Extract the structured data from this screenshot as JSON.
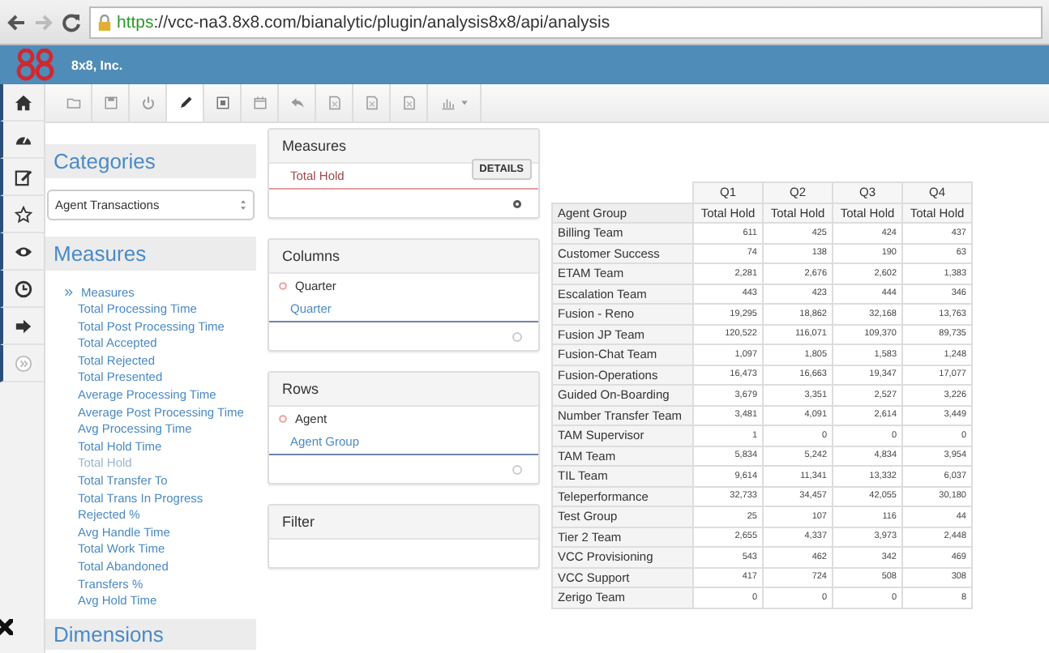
{
  "browser": {
    "url_scheme": "https",
    "url_rest": "://vcc-na3.8x8.com/bianalytic/plugin/analysis8x8/api/analysis"
  },
  "header": {
    "company": "8x8, Inc."
  },
  "side_nav": [
    {
      "kind": "home"
    },
    {
      "kind": "dashboard"
    },
    {
      "kind": "edit"
    },
    {
      "kind": "star"
    },
    {
      "kind": "eye"
    },
    {
      "kind": "clock"
    },
    {
      "kind": "signout"
    },
    {
      "kind": "expand"
    }
  ],
  "toolbar": [
    {
      "kind": "folder",
      "selected": false
    },
    {
      "kind": "save",
      "selected": false
    },
    {
      "kind": "power",
      "selected": false
    },
    {
      "kind": "pencil",
      "selected": true
    },
    {
      "kind": "play",
      "selected": false
    },
    {
      "kind": "calendar",
      "selected": false
    },
    {
      "kind": "undo",
      "selected": false
    },
    {
      "kind": "doc",
      "selected": false
    },
    {
      "kind": "doc",
      "selected": false
    },
    {
      "kind": "doc",
      "selected": false
    },
    {
      "kind": "chart",
      "selected": false
    }
  ],
  "categories": {
    "title": "Categories",
    "value": "Agent Transactions"
  },
  "measures_list": {
    "title": "Measures",
    "group": "Measures",
    "items": [
      {
        "label": "Total Processing Time",
        "disabled": false
      },
      {
        "label": "Total Post Processing Time",
        "disabled": false
      },
      {
        "label": "Total Accepted",
        "disabled": false
      },
      {
        "label": "Total Rejected",
        "disabled": false
      },
      {
        "label": "Total Presented",
        "disabled": false
      },
      {
        "label": "Average Processing Time",
        "disabled": false
      },
      {
        "label": "Average Post Processing Time",
        "disabled": false
      },
      {
        "label": "Avg Processing Time",
        "disabled": false
      },
      {
        "label": "Total Hold Time",
        "disabled": false
      },
      {
        "label": "Total Hold",
        "disabled": true
      },
      {
        "label": "Total Transfer To",
        "disabled": false
      },
      {
        "label": "Total Trans In Progress",
        "disabled": false
      },
      {
        "label": "Rejected %",
        "disabled": false
      },
      {
        "label": "Avg Handle Time",
        "disabled": false
      },
      {
        "label": "Total Work Time",
        "disabled": false
      },
      {
        "label": "Total Abandoned",
        "disabled": false
      },
      {
        "label": "Transfers %",
        "disabled": false
      },
      {
        "label": "Avg Hold Time",
        "disabled": false
      }
    ]
  },
  "dimensions": {
    "title": "Dimensions"
  },
  "drop_panels": [
    {
      "kind": "measures",
      "title": "Measures",
      "measure": "Total Hold",
      "button": "DETAILS"
    },
    {
      "kind": "dimension",
      "title": "Columns",
      "dimension": "Quarter",
      "level": "Quarter"
    },
    {
      "kind": "dimension",
      "title": "Rows",
      "dimension": "Agent",
      "level": "Agent Group"
    },
    {
      "kind": "filter",
      "title": "Filter"
    }
  ],
  "table": {
    "column_groups": [
      "Q1",
      "Q2",
      "Q3",
      "Q4"
    ],
    "row_header": "Agent Group",
    "measure_headers": [
      "Total Hold",
      "Total Hold",
      "Total Hold",
      "Total Hold"
    ],
    "rows": [
      {
        "label": "Billing Team",
        "values": [
          "611",
          "425",
          "424",
          "437"
        ]
      },
      {
        "label": "Customer Success",
        "values": [
          "74",
          "138",
          "190",
          "63"
        ]
      },
      {
        "label": "ETAM Team",
        "values": [
          "2,281",
          "2,676",
          "2,602",
          "1,383"
        ]
      },
      {
        "label": "Escalation Team",
        "values": [
          "443",
          "423",
          "444",
          "346"
        ]
      },
      {
        "label": "Fusion - Reno",
        "values": [
          "19,295",
          "18,862",
          "32,168",
          "13,763"
        ]
      },
      {
        "label": "Fusion JP Team",
        "values": [
          "120,522",
          "116,071",
          "109,370",
          "89,735"
        ]
      },
      {
        "label": "Fusion-Chat Team",
        "values": [
          "1,097",
          "1,805",
          "1,583",
          "1,248"
        ]
      },
      {
        "label": "Fusion-Operations",
        "values": [
          "16,473",
          "16,663",
          "19,347",
          "17,077"
        ]
      },
      {
        "label": "Guided On-Boarding",
        "values": [
          "3,679",
          "3,351",
          "2,527",
          "3,226"
        ]
      },
      {
        "label": "Number Transfer Team",
        "values": [
          "3,481",
          "4,091",
          "2,614",
          "3,449"
        ]
      },
      {
        "label": "TAM Supervisor",
        "values": [
          "1",
          "0",
          "0",
          "0"
        ]
      },
      {
        "label": "TAM Team",
        "values": [
          "5,834",
          "5,242",
          "4,834",
          "3,954"
        ]
      },
      {
        "label": "TIL Team",
        "values": [
          "9,614",
          "11,341",
          "13,332",
          "6,037"
        ]
      },
      {
        "label": "Teleperformance",
        "values": [
          "32,733",
          "34,457",
          "42,055",
          "30,180"
        ]
      },
      {
        "label": "Test Group",
        "values": [
          "25",
          "107",
          "116",
          "44"
        ]
      },
      {
        "label": "Tier 2 Team",
        "values": [
          "2,655",
          "4,337",
          "3,973",
          "2,448"
        ]
      },
      {
        "label": "VCC Provisioning",
        "values": [
          "543",
          "462",
          "342",
          "469"
        ]
      },
      {
        "label": "VCC Support",
        "values": [
          "417",
          "724",
          "508",
          "308"
        ]
      },
      {
        "label": "Zerigo Team",
        "values": [
          "0",
          "0",
          "0",
          "8"
        ]
      }
    ]
  }
}
